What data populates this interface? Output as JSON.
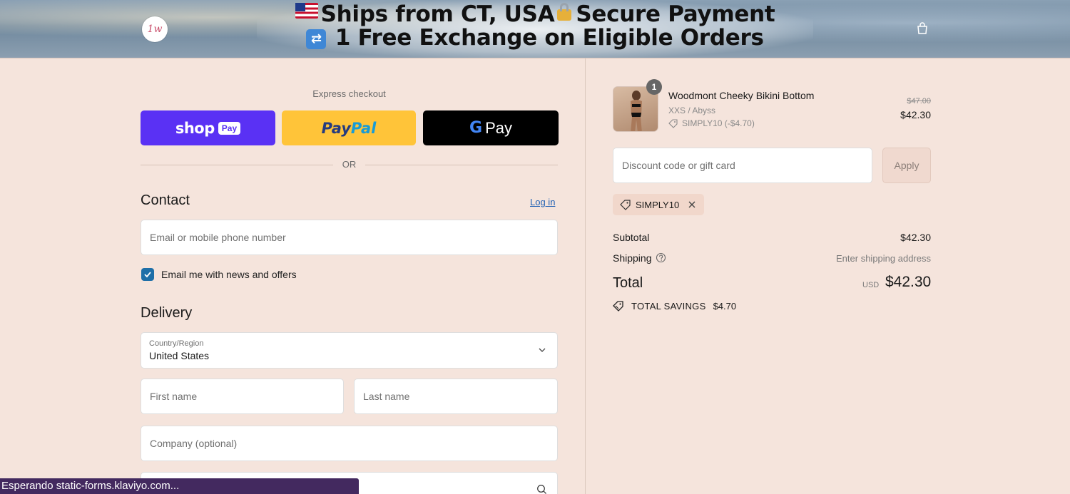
{
  "banner": {
    "line1_left": "Ships from CT, USA",
    "line1_right": "Secure Payment",
    "line2": "1 Free Exchange on Eligible Orders",
    "logo_text": "1w"
  },
  "express": {
    "label": "Express checkout",
    "shop_word": "shop",
    "shop_pay": "Pay",
    "paypal_a": "Pay",
    "paypal_b": "Pal",
    "gpay_g": "G",
    "gpay_word": "Pay",
    "or": "OR"
  },
  "contact": {
    "title": "Contact",
    "login": "Log in",
    "email_placeholder": "Email or mobile phone number",
    "newsletter_label": "Email me with news and offers",
    "newsletter_checked": true
  },
  "delivery": {
    "title": "Delivery",
    "country_label": "Country/Region",
    "country_value": "United States",
    "first_name_placeholder": "First name",
    "last_name_placeholder": "Last name",
    "company_placeholder": "Company (optional)"
  },
  "status_bar": "Esperando static-forms.klaviyo.com...",
  "cart": {
    "item": {
      "quantity": "1",
      "name": "Woodmont Cheeky Bikini Bottom",
      "variant": "XXS / Abyss",
      "discount": "SIMPLY10 (-$4.70)",
      "price_original": "$47.00",
      "price_final": "$42.30"
    },
    "discount_placeholder": "Discount code or gift card",
    "apply": "Apply",
    "applied_code": "SIMPLY10",
    "subtotal_label": "Subtotal",
    "subtotal_value": "$42.30",
    "shipping_label": "Shipping",
    "shipping_value": "Enter shipping address",
    "total_label": "Total",
    "total_currency": "USD",
    "total_value": "$42.30",
    "savings_label": "TOTAL SAVINGS",
    "savings_value": "$4.70"
  }
}
